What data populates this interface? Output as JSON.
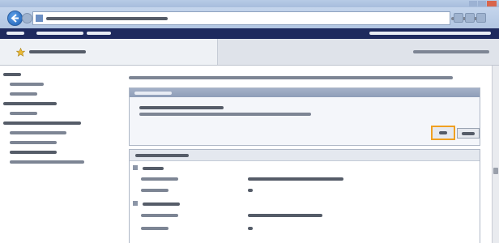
{
  "browser": {
    "back_icon": "back-arrow-icon",
    "forward_icon": "forward-arrow-icon",
    "site_icon": "site-favicon-icon",
    "favorites_icon": "favorites-star-icon"
  },
  "colors": {
    "links_bar": "#1e2a5e",
    "panel_header": "#97a6bf",
    "ok_highlight": "#f0a020"
  },
  "sidebar": {
    "items": [
      {
        "indent": 0,
        "text_len": 22
      },
      {
        "indent": 1,
        "text_len": 42
      },
      {
        "indent": 1,
        "text_len": 34
      },
      {
        "indent": 0,
        "text_len": 66
      },
      {
        "indent": 1,
        "text_len": 34
      },
      {
        "indent": 0,
        "text_len": 96
      },
      {
        "indent": 1,
        "text_len": 70
      },
      {
        "indent": 1,
        "text_len": 58
      },
      {
        "indent": 1,
        "text_len": 58,
        "selected": true
      },
      {
        "indent": 1,
        "text_len": 92
      }
    ]
  },
  "settings": {
    "sections": [
      {
        "rows": [
          {
            "label_len": 46,
            "value_len": 118
          },
          {
            "label_len": 34,
            "value_len": 6
          }
        ]
      },
      {
        "rows": [
          {
            "label_len": 46,
            "value_len": 92
          },
          {
            "label_len": 34,
            "value_len": 6
          }
        ]
      }
    ]
  }
}
